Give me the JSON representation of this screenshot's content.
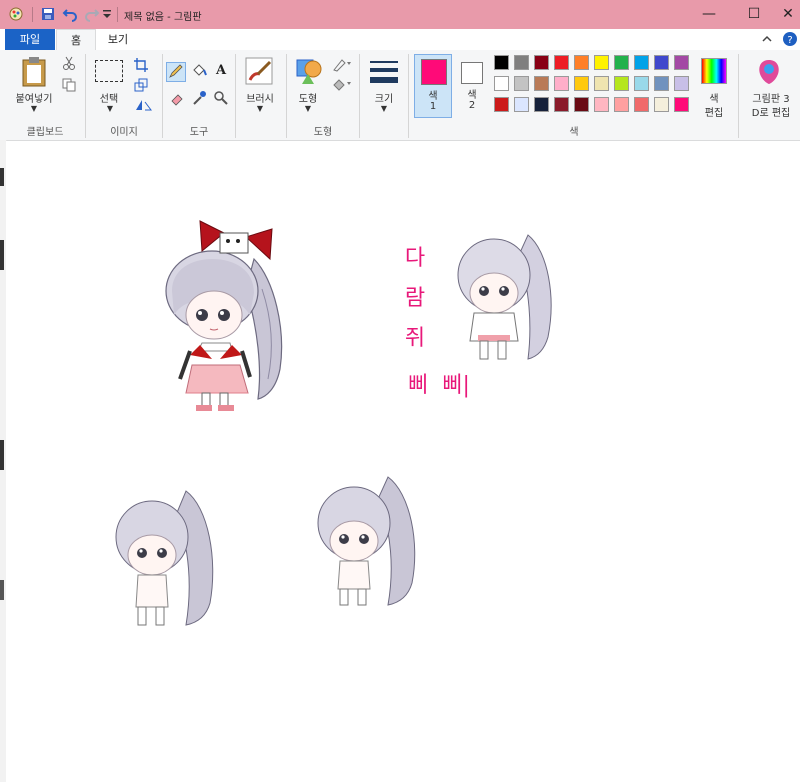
{
  "titlebar": {
    "title": "제목 없음 - 그림판",
    "minimize": "—",
    "maximize": "☐",
    "close": "✕"
  },
  "tabs": [
    "파일",
    "홈",
    "보기"
  ],
  "ribbon": {
    "clipboard": {
      "paste_label": "붙여넣기",
      "group_label": "클립보드"
    },
    "image": {
      "select_label": "선택",
      "group_label": "이미지"
    },
    "tools": {
      "group_label": "도구",
      "text_glyph": "A"
    },
    "brushes": {
      "label": "브러시"
    },
    "shapes": {
      "label": "도형",
      "group_label": "도형"
    },
    "size": {
      "label": "크기"
    },
    "color1": {
      "label_line1": "색",
      "label_line2": "1",
      "color": "#ff0a78"
    },
    "color2": {
      "label_line1": "색",
      "label_line2": "2",
      "color": "#ffffff"
    },
    "colors_group_label": "색",
    "edit_colors": {
      "line1": "색",
      "line2": "편집"
    },
    "paint3d": {
      "line1": "그림판 3",
      "line2": "D로 편집"
    }
  },
  "palette": {
    "row1": [
      "#000000",
      "#7f7f7f",
      "#880015",
      "#ed1c24",
      "#ff7f27",
      "#fff200",
      "#22b14c",
      "#00a2e8",
      "#3f48cc",
      "#a349a4"
    ],
    "row2": [
      "#ffffff",
      "#c3c3c3",
      "#b97a57",
      "#ffaec9",
      "#ffc90e",
      "#efe4b0",
      "#b5e61d",
      "#99d9ea",
      "#7092be",
      "#c8bfe7"
    ],
    "row3": [
      "#cc1a1a",
      "#dbe6ff",
      "#16213a",
      "#8a1a2a",
      "#6a0a14",
      "#ffb6c1",
      "#ffa0a0",
      "#f06a6a",
      "#f5efdc",
      "#ff0a78"
    ]
  },
  "canvas": {
    "handwriting_vertical": [
      "다",
      "람",
      "쥐"
    ],
    "handwriting_line": "삐  삐|"
  }
}
